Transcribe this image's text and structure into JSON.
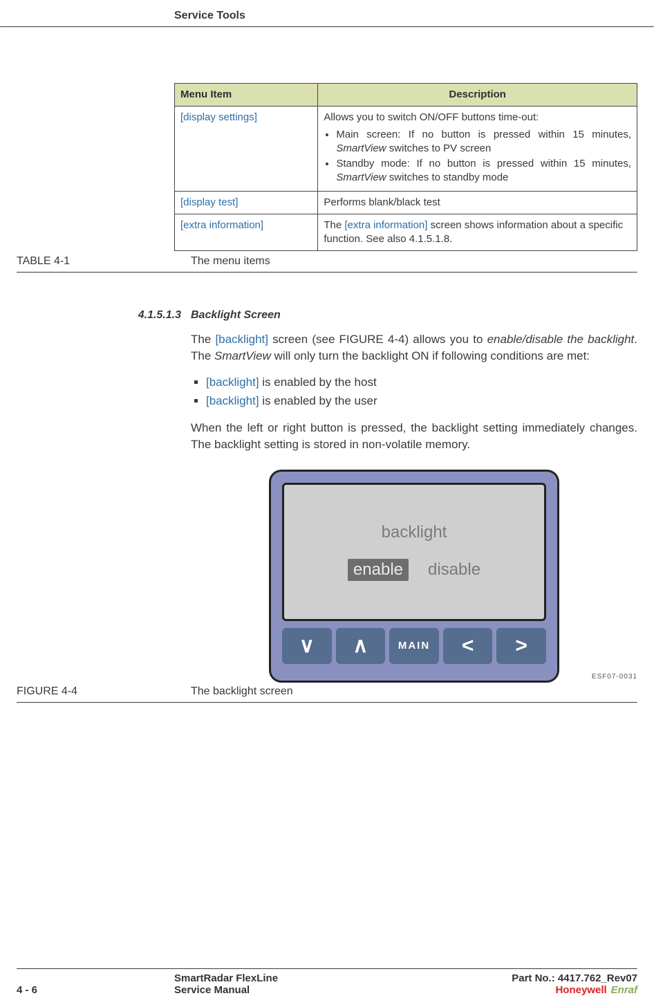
{
  "header": {
    "section_title": "Service Tools"
  },
  "table": {
    "headers": [
      "Menu Item",
      "Description"
    ],
    "rows": [
      {
        "item": "[display settings]",
        "desc_intro": "Allows you to switch ON/OFF buttons time-out:",
        "bullets": [
          {
            "pre": "Main screen: If no button is pressed within 15 minutes, ",
            "em": "SmartView",
            "post": " switches to PV screen"
          },
          {
            "pre": "Standby mode: If no button is pressed within 15 minutes, ",
            "em": "SmartView",
            "post": " switches to standby mode"
          }
        ]
      },
      {
        "item": "[display test]",
        "desc": "Performs blank/black test"
      },
      {
        "item": "[extra information]",
        "desc_pre": "The ",
        "desc_link": "[extra information]",
        "desc_post": " screen shows information about a specific function. See also 4.1.5.1.8."
      }
    ],
    "caption_label": "TABLE  4-1",
    "caption_text": "The menu items"
  },
  "subsection": {
    "number": "4.1.5.1.3",
    "title": "Backlight Screen",
    "para1_pre": "The ",
    "para1_link": "[backlight]",
    "para1_mid1": " screen (see FIGURE 4-4) allows you to ",
    "para1_em1": "enable/disable the backlight",
    "para1_mid2": ". The ",
    "para1_em2": "SmartView",
    "para1_post": " will only turn the backlight ON if following conditions are met:",
    "bullets": [
      {
        "link": "[backlight]",
        "text": " is enabled by the host"
      },
      {
        "link": "[backlight]",
        "text": " is enabled by the user"
      }
    ],
    "para2": "When the left or right button is pressed, the backlight setting immediately changes. The backlight setting is stored in non-volatile memory."
  },
  "figure": {
    "screen_title": "backlight",
    "option_selected": "enable",
    "option_other": "disable",
    "buttons": {
      "down": "∨",
      "up": "∧",
      "main": "MAIN",
      "left": "<",
      "right": ">"
    },
    "code": "ESF07-0031",
    "caption_label": "FIGURE  4-4",
    "caption_text": "The backlight screen"
  },
  "footer": {
    "page_num": "4 - 6",
    "doc_title": "SmartRadar FlexLine",
    "doc_sub": "Service Manual",
    "part_no": "Part No.: 4417.762_Rev07",
    "logo_hw": "Honeywell",
    "logo_en": "Enraf"
  }
}
